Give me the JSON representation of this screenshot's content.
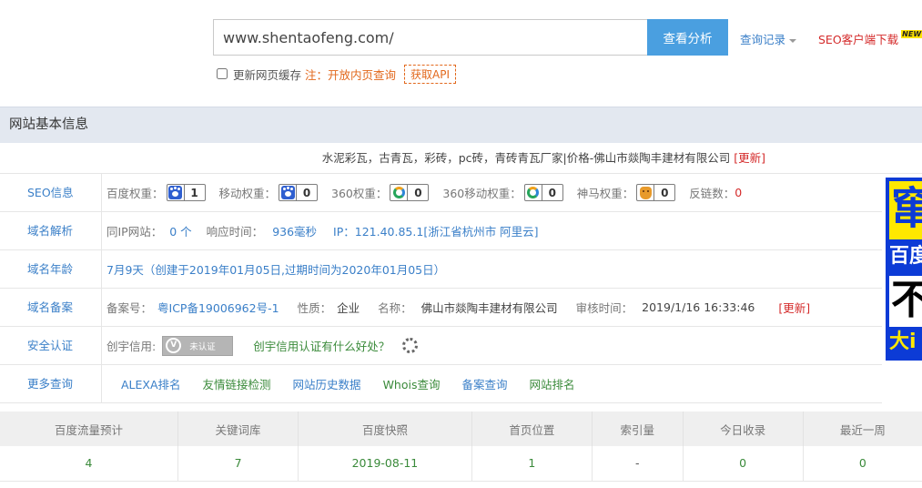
{
  "search": {
    "value": "www.shentaofeng.com/",
    "button_label": "查看分析"
  },
  "history_label": "查询记录",
  "download_label": "SEO客户端下载",
  "download_badge": "NEW",
  "options": {
    "cache_label": "更新网页缓存",
    "note": "注：开放内页查询",
    "api_label": "获取API"
  },
  "section": {
    "title": "网站基本信息",
    "site_title": "水泥彩瓦，古青瓦，彩砖，pc砖，青砖青瓦厂家|价格-佛山市燚陶丰建材有限公司",
    "refresh_label": "[更新]"
  },
  "seo": {
    "label": "SEO信息",
    "baidu_label": "百度权重：",
    "baidu_value": "1",
    "mobile_label": "移动权重：",
    "mobile_value": "0",
    "s360_label": "360权重：",
    "s360_value": "0",
    "s360m_label": "360移动权重：",
    "s360m_value": "0",
    "shenma_label": "神马权重：",
    "shenma_value": "0",
    "backlink_label": "反链数：",
    "backlink_value": "0"
  },
  "dns": {
    "label": "域名解析",
    "same_ip_label": "同IP网站：",
    "same_ip_value": "0 个",
    "response_label": "响应时间：",
    "response_value": "936毫秒",
    "ip_value": "IP：121.40.85.1[浙江省杭州市 阿里云]"
  },
  "age": {
    "label": "域名年龄",
    "value": "7月9天（创建于2019年01月05日,过期时间为2020年01月05日）"
  },
  "icp": {
    "label": "域名备案",
    "no_label": "备案号：",
    "no_value": "粤ICP备19006962号-1",
    "nature_label": "性质：",
    "nature_value": "企业",
    "name_label": "名称：",
    "name_value": "佛山市燚陶丰建材有限公司",
    "audit_label": "审核时间：",
    "audit_value": "2019/1/16 16:33:46",
    "refresh_label": "[更新]"
  },
  "security": {
    "label": "安全认证",
    "credit_label": "创宇信用:",
    "badge_text": "未认证",
    "badge_v": "V",
    "benefit_link": "创宇信用认证有什么好处？"
  },
  "more": {
    "label": "更多查询",
    "links": [
      "ALEXA排名",
      "友情链接检测",
      "网站历史数据",
      "Whois查询",
      "备案查询",
      "网站排名"
    ]
  },
  "stats": {
    "headers": [
      "百度流量预计",
      "关键词库",
      "百度快照",
      "首页位置",
      "索引量",
      "今日收录",
      "最近一周"
    ],
    "values": [
      "4",
      "7",
      "2019-08-11",
      "1",
      "-",
      "0",
      "0"
    ]
  },
  "ad": {
    "line1": "窜",
    "line2": "百度",
    "line3": "不",
    "line4": "大i"
  },
  "colors": {
    "accent_blue": "#4a9fe0",
    "link_blue": "#3a7fc8",
    "value_green": "#3a8a3a",
    "alert_red": "#d42a2a",
    "note_orange": "#e2681c",
    "header_bg": "#e3e8f0"
  }
}
